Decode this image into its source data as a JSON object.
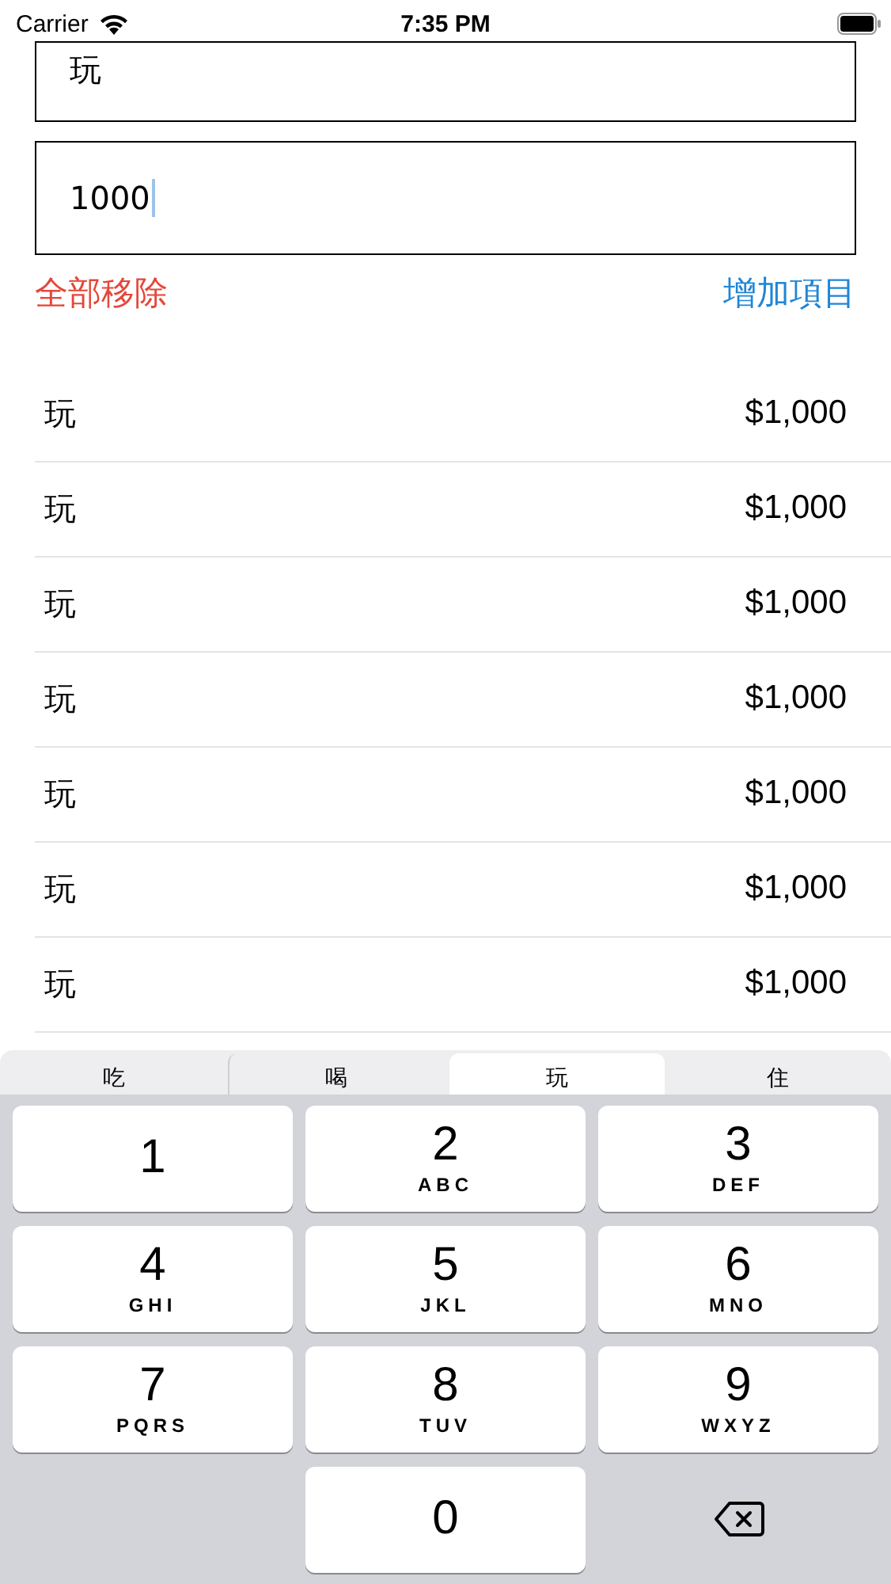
{
  "status_bar": {
    "carrier": "Carrier",
    "time": "7:35 PM"
  },
  "name_field": {
    "value": "玩"
  },
  "amount_field": {
    "value": "1000",
    "focused": true
  },
  "actions": {
    "remove_all": "全部移除",
    "add_item": "增加項目"
  },
  "items": [
    {
      "name": "玩",
      "amount": "$1,000"
    },
    {
      "name": "玩",
      "amount": "$1,000"
    },
    {
      "name": "玩",
      "amount": "$1,000"
    },
    {
      "name": "玩",
      "amount": "$1,000"
    },
    {
      "name": "玩",
      "amount": "$1,000"
    },
    {
      "name": "玩",
      "amount": "$1,000"
    },
    {
      "name": "玩",
      "amount": "$1,000"
    }
  ],
  "category_segments": [
    {
      "label": "吃",
      "selected": false
    },
    {
      "label": "喝",
      "selected": false
    },
    {
      "label": "玩",
      "selected": true
    },
    {
      "label": "住",
      "selected": false
    }
  ],
  "keypad": [
    {
      "kind": "digit",
      "digit": "1"
    },
    {
      "kind": "digit",
      "digit": "2",
      "letters": "ABC"
    },
    {
      "kind": "digit",
      "digit": "3",
      "letters": "DEF"
    },
    {
      "kind": "digit",
      "digit": "4",
      "letters": "GHI"
    },
    {
      "kind": "digit",
      "digit": "5",
      "letters": "JKL"
    },
    {
      "kind": "digit",
      "digit": "6",
      "letters": "MNO"
    },
    {
      "kind": "digit",
      "digit": "7",
      "letters": "PQRS"
    },
    {
      "kind": "digit",
      "digit": "8",
      "letters": "TUV"
    },
    {
      "kind": "digit",
      "digit": "9",
      "letters": "WXYZ"
    },
    {
      "kind": "blank"
    },
    {
      "kind": "digit",
      "digit": "0"
    },
    {
      "kind": "delete"
    }
  ]
}
